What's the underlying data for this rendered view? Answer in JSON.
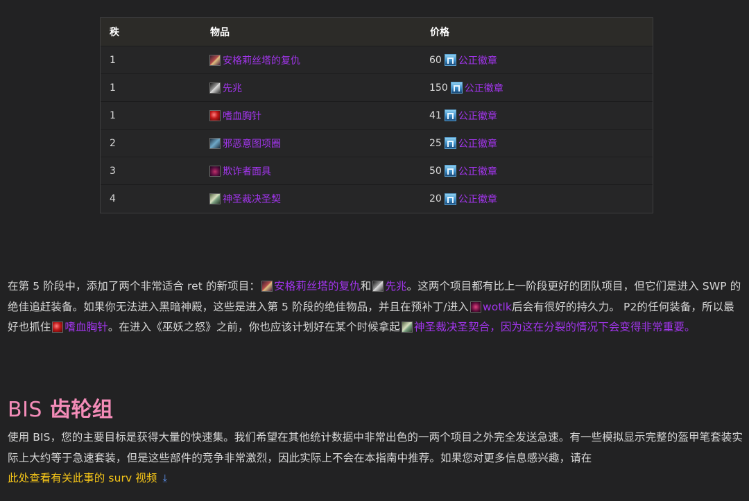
{
  "table": {
    "headers": [
      "秩",
      "物品",
      "价格"
    ],
    "rows": [
      {
        "rank": "1",
        "item": "安格莉丝塔的复仇",
        "icon": "dagger-icon",
        "price": "60",
        "currency": "公正徽章"
      },
      {
        "rank": "1",
        "item": "先兆",
        "icon": "omen-icon",
        "price": "150",
        "currency": "公正徽章"
      },
      {
        "rank": "1",
        "item": "嗜血胸针",
        "icon": "brooch-icon",
        "price": "41",
        "currency": "公正徽章"
      },
      {
        "rank": "2",
        "item": "邪恶意图项圈",
        "icon": "collar-icon",
        "price": "25",
        "currency": "公正徽章"
      },
      {
        "rank": "3",
        "item": "欺诈者面具",
        "icon": "mask-icon",
        "price": "50",
        "currency": "公正徽章"
      },
      {
        "rank": "4",
        "item": "神圣裁决圣契",
        "icon": "libram-icon",
        "price": "20",
        "currency": "公正徽章"
      }
    ]
  },
  "paragraph1": {
    "t1": "在第 5 阶段中，添加了两个非常适合 ret 的新项目：",
    "link1": "安格莉丝塔的复仇",
    "t2": "和",
    "link2": "先兆",
    "t3": "。这两个项目都有比上一阶段更好的团队项目，但它们是进入 SWP 的绝佳追赶装备。如果你无法进入黑暗神殿，这些是进入第 5 阶段的绝佳物品，并且在预补丁/进入",
    "link3": "wotlk",
    "t4": "后会有很好的持久力。 P2的任何装备，所以最好也抓住",
    "link4": "嗜血胸针",
    "t5": "。在进入《巫妖之怒》之前，你也应该计划好在某个时候拿起",
    "link5": "神圣裁决圣契合，因为这在分裂的情况下会变得非常重要。"
  },
  "heading": {
    "latin": "BIS",
    "cjk": "齿轮组"
  },
  "paragraph2": {
    "text": "使用 BIS，您的主要目标是获得大量的快速集。我们希望在其他统计数据中非常出色的一两个项目之外完全发送急速。有一些模拟显示完整的盔甲笔套装实际上大约等于急速套装，但是这些部件的竞争非常激烈，因此实际上不会在本指南中推荐。如果您对更多信息感兴趣，请在",
    "link": "此处查看有关此事的 surv 视频",
    "download_glyph": "⤓"
  },
  "colors": {
    "background": "#222223",
    "epic_item": "#a335ee",
    "heading": "#f48cb8",
    "link_yellow": "#f5c518"
  }
}
